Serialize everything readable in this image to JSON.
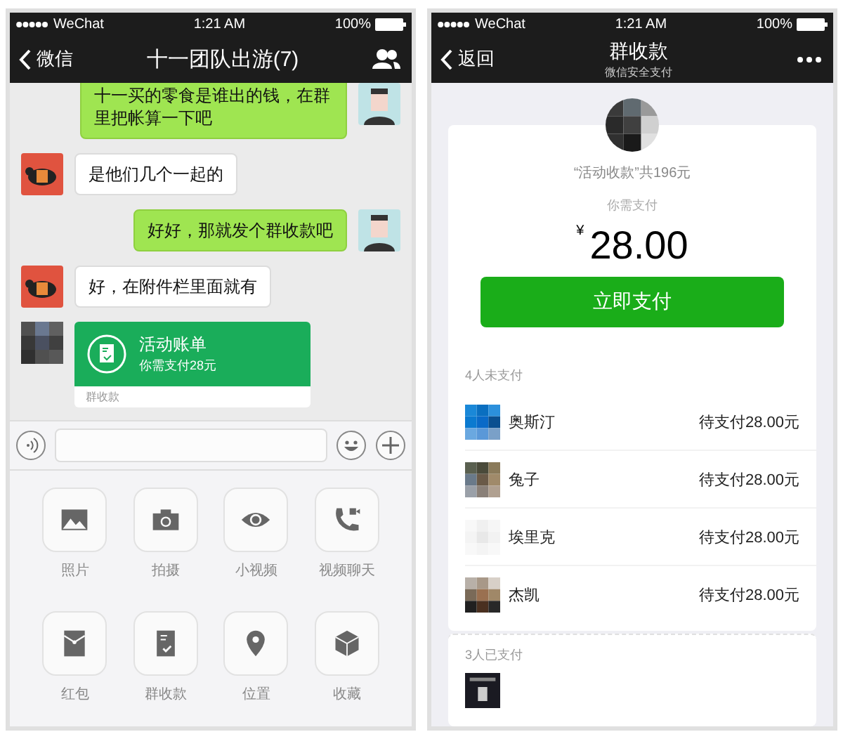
{
  "chat_screen": {
    "status_bar": {
      "carrier": "WeChat",
      "time": "1:21 AM",
      "battery": "100%"
    },
    "nav": {
      "back": "微信",
      "title": "十一团队出游(7)"
    },
    "messages": [
      {
        "kind": "text",
        "outgoing": true,
        "text": "十一买的零食是谁出的钱，在群里把帐算一下吧"
      },
      {
        "kind": "text",
        "outgoing": false,
        "text": "是他们几个一起的"
      },
      {
        "kind": "text",
        "outgoing": true,
        "text": "好好，那就发个群收款吧"
      },
      {
        "kind": "text",
        "outgoing": false,
        "text": "好，在附件栏里面就有"
      },
      {
        "kind": "bill",
        "outgoing": false,
        "title": "活动账单",
        "subtitle": "你需支付28元",
        "footer": "群收款"
      }
    ],
    "attachments": [
      {
        "label": "照片"
      },
      {
        "label": "拍摄"
      },
      {
        "label": "小视频"
      },
      {
        "label": "视频聊天"
      },
      {
        "label": "红包"
      },
      {
        "label": "群收款"
      },
      {
        "label": "位置"
      },
      {
        "label": "收藏"
      }
    ]
  },
  "payment_screen": {
    "status_bar": {
      "carrier": "WeChat",
      "time": "1:21 AM",
      "battery": "100%"
    },
    "nav": {
      "back": "返回",
      "title": "群收款",
      "subtitle": "微信安全支付"
    },
    "summary": "“活动收款”共196元",
    "prompt": "你需支付",
    "currency": "¥",
    "amount": "28.00",
    "pay_button": "立即支付",
    "unpaid_header": "4人未支付",
    "unpaid": [
      {
        "name": "奥斯汀",
        "status": "待支付28.00元"
      },
      {
        "name": "兔子",
        "status": "待支付28.00元"
      },
      {
        "name": "埃里克",
        "status": "待支付28.00元"
      },
      {
        "name": "杰凯",
        "status": "待支付28.00元"
      }
    ],
    "paid_header": "3人已支付"
  }
}
